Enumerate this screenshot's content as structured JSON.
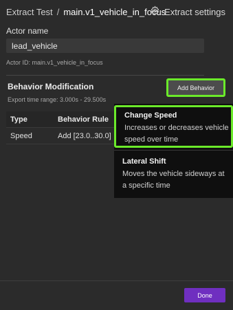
{
  "header": {
    "breadcrumb_root": "Extract Test",
    "breadcrumb_separator": "/",
    "breadcrumb_current": "main.v1_vehicle_in_focus",
    "settings_label": "Extract settings",
    "settings_icon": "gear-icon"
  },
  "actor": {
    "name_label": "Actor name",
    "name_value": "lead_vehicle",
    "id_text": "Actor ID: main.v1_vehicle_in_focus"
  },
  "behavior": {
    "title": "Behavior Modification",
    "time_range": "Export time range: 3.000s - 29.500s",
    "add_button": "Add Behavior",
    "columns": [
      "Type",
      "Behavior Rule"
    ],
    "rows": [
      {
        "type": "Speed",
        "rule": "Add [23.0..30.0]"
      }
    ]
  },
  "dropdown": {
    "items": [
      {
        "title": "Change Speed",
        "desc_line1": "Increases or decreases vehicle",
        "desc_line2": "speed over time"
      },
      {
        "title": "Lateral Shift",
        "desc_line1": "Moves the vehicle sideways at",
        "desc_line2": "a specific time"
      }
    ]
  },
  "footer": {
    "done_label": "Done"
  },
  "colors": {
    "highlight": "#6bea2a",
    "primary_button": "#6f2fc0",
    "background": "#2b2b2b"
  }
}
